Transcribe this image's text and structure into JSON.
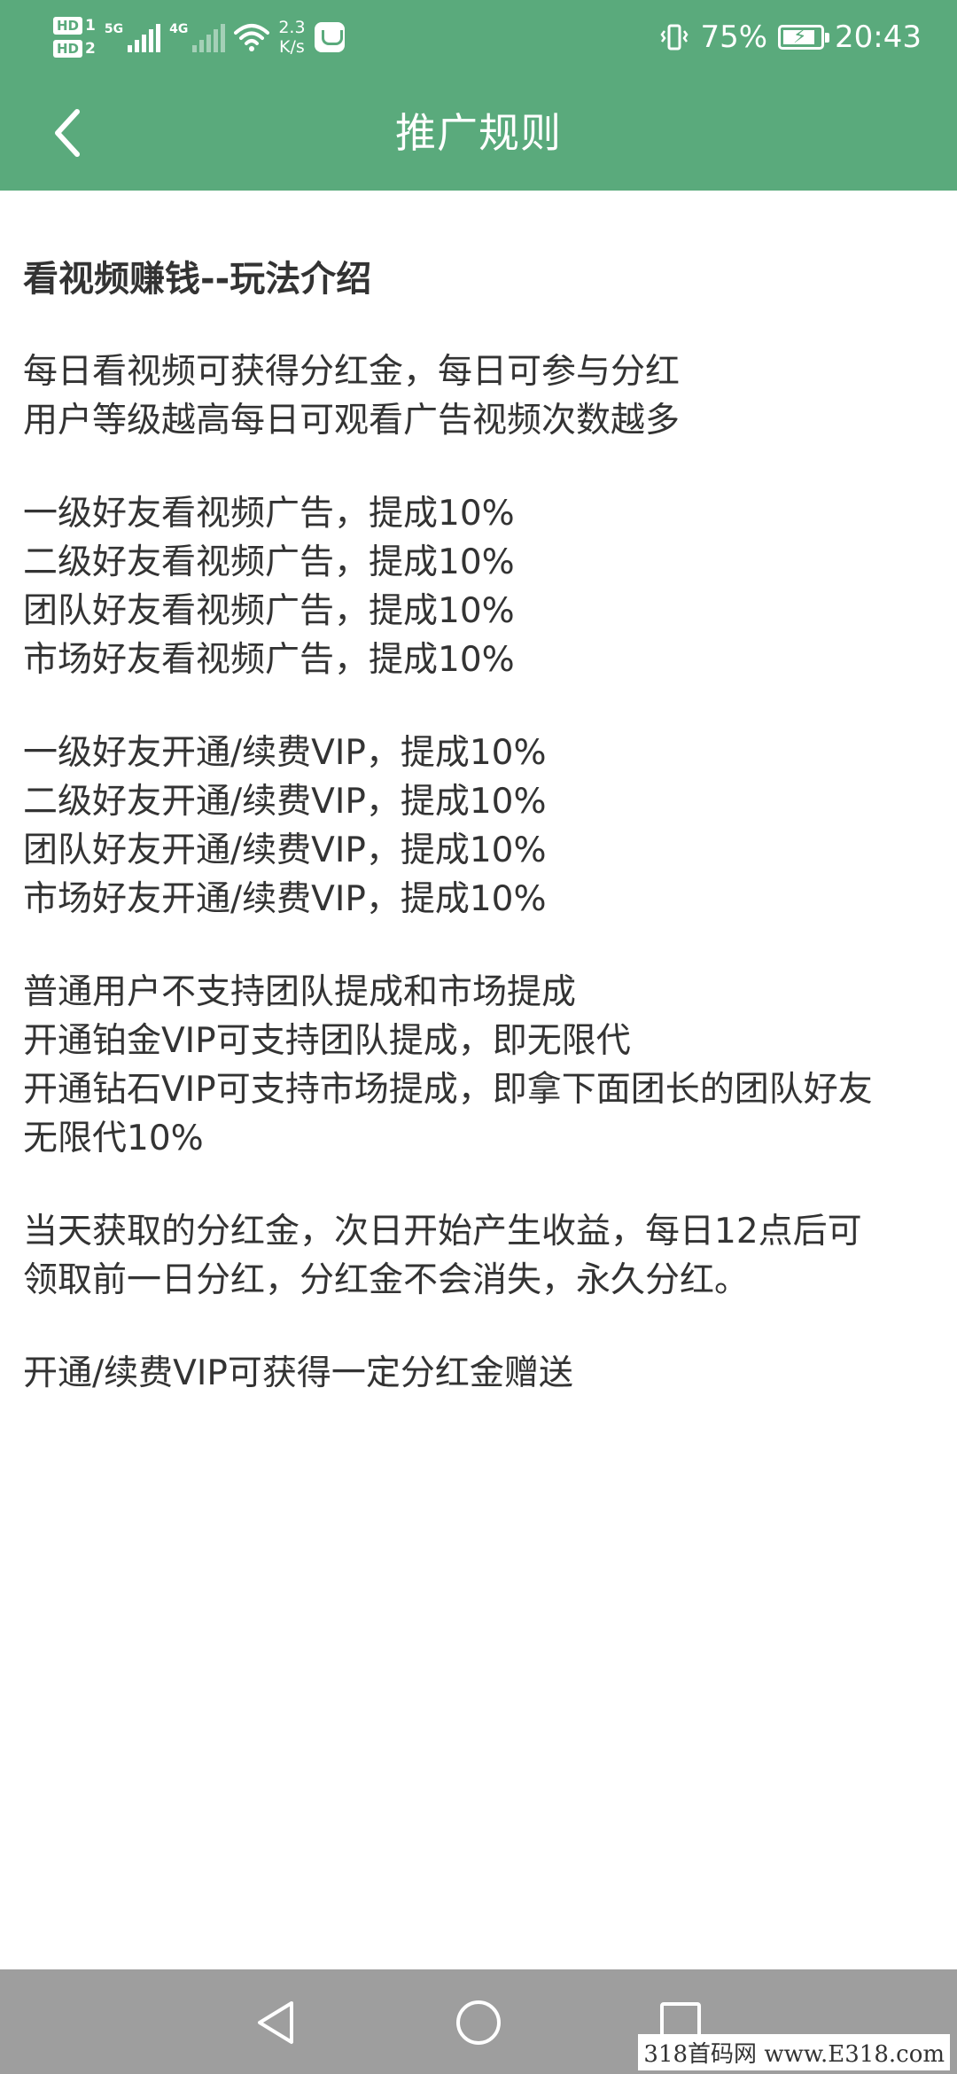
{
  "status_bar": {
    "hd1": "HD",
    "hd1_num": "1",
    "hd2": "HD",
    "hd2_num": "2",
    "sig1_tag": "5G",
    "sig2_tag": "4G",
    "speed_value": "2.3",
    "speed_unit": "K/s",
    "battery_percent": "75%",
    "time": "20:43"
  },
  "titlebar": {
    "title": "推广规则"
  },
  "content": {
    "heading": "看视频赚钱--玩法介绍",
    "sections": [
      [
        "每日看视频可获得分红金，每日可参与分红",
        "用户等级越高每日可观看广告视频次数越多"
      ],
      [
        "一级好友看视频广告，提成10%",
        "二级好友看视频广告，提成10%",
        "团队好友看视频广告，提成10%",
        "市场好友看视频广告，提成10%"
      ],
      [
        "一级好友开通/续费VIP，提成10%",
        "二级好友开通/续费VIP，提成10%",
        "团队好友开通/续费VIP，提成10%",
        "市场好友开通/续费VIP，提成10%"
      ],
      [
        "普通用户不支持团队提成和市场提成",
        "开通铂金VIP可支持团队提成，即无限代",
        "开通钻石VIP可支持市场提成，即拿下面团长的团队好友",
        "无限代10%"
      ],
      [
        "当天获取的分红金，次日开始产生收益，每日12点后可",
        "领取前一日分红，分红金不会消失，永久分红。"
      ],
      [
        "开通/续费VIP可获得一定分红金赠送"
      ]
    ]
  },
  "watermark": "318首码网 www.E318.com",
  "colors": {
    "header": "#5aaa7c",
    "navbar": "#9e9e9e",
    "text": "#333333"
  },
  "icons": {
    "back": "chevron-left-icon",
    "nav_back": "triangle-back-icon",
    "nav_home": "circle-home-icon",
    "nav_recent": "square-recent-icon"
  }
}
